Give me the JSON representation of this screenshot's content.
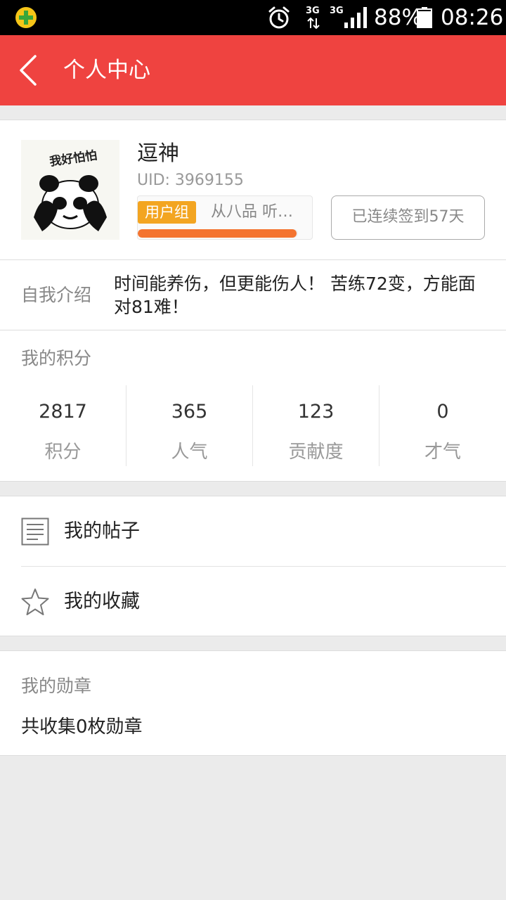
{
  "status_bar": {
    "network_1": "3G",
    "network_2": "3G",
    "battery": "88%",
    "time": "08:26"
  },
  "header": {
    "title": "个人中心"
  },
  "profile": {
    "avatar_text": "我好怕怕",
    "username": "逗神",
    "uid": "UID: 3969155",
    "group_badge": "用户组",
    "group_rank": "从八品 听…",
    "exp_progress": 0.99,
    "checkin_label": "已连续签到57天"
  },
  "intro": {
    "label": "自我介绍",
    "text": "时间能养伤，但更能伤人！ 苦练72变，方能面对81难！"
  },
  "points": {
    "title": "我的积分",
    "stats": [
      {
        "value": "2817",
        "label": "积分"
      },
      {
        "value": "365",
        "label": "人气"
      },
      {
        "value": "123",
        "label": "贡献度"
      },
      {
        "value": "0",
        "label": "才气"
      }
    ]
  },
  "menu": {
    "items": [
      {
        "label": "我的帖子",
        "icon": "document-icon"
      },
      {
        "label": "我的收藏",
        "icon": "star-icon"
      }
    ]
  },
  "medals": {
    "title": "我的勋章",
    "summary": "共收集0枚勋章"
  },
  "colors": {
    "header": "#ef4340",
    "badge": "#f3a521",
    "progress": "#f47430"
  }
}
